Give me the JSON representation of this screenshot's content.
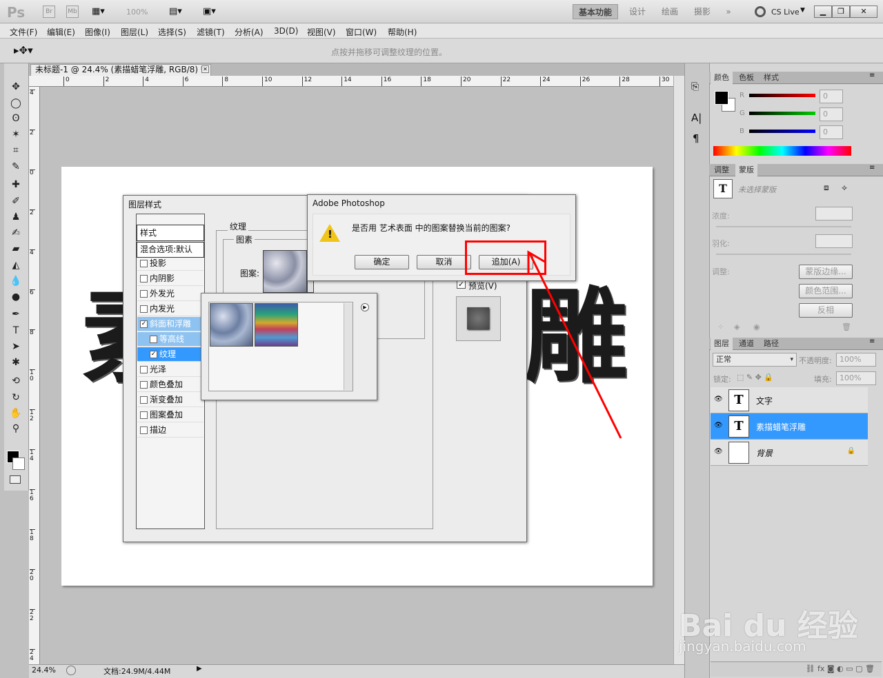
{
  "app": {
    "logo": "Ps",
    "bridge": "Br",
    "minibridge": "Mb",
    "zoom": "100%",
    "cslive": "CS Live"
  },
  "workspaces": [
    "基本功能",
    "设计",
    "绘画",
    "摄影"
  ],
  "menu": [
    "文件(F)",
    "编辑(E)",
    "图像(I)",
    "图层(L)",
    "选择(S)",
    "滤镜(T)",
    "分析(A)",
    "3D(D)",
    "视图(V)",
    "窗口(W)",
    "帮助(H)"
  ],
  "options": {
    "hint": "点按并拖移可调整纹理的位置。"
  },
  "document": {
    "tab_title": "未标题-1 @ 24.4% (素描蜡笔浮雕, RGB/8) *",
    "canvas_text_left": "素",
    "canvas_text_right": "雕",
    "zoom": "24.4%",
    "doc_size": "文档:24.9M/4.44M"
  },
  "ruler_h": [
    "0",
    "2",
    "4",
    "6",
    "8",
    "10",
    "12",
    "14",
    "16",
    "18",
    "20",
    "22",
    "24",
    "26",
    "28",
    "30"
  ],
  "ruler_v": [
    "4",
    "2",
    "0",
    "2",
    "4",
    "6",
    "8",
    "1 0",
    "1 2",
    "1 4",
    "1 6",
    "1 8",
    "2 0",
    "2 2",
    "2 4"
  ],
  "layer_style": {
    "title": "图层样式",
    "styles_header": "样式",
    "blend_options": "混合选项:默认",
    "items": [
      {
        "label": "投影",
        "checked": false
      },
      {
        "label": "内阴影",
        "checked": false
      },
      {
        "label": "外发光",
        "checked": false
      },
      {
        "label": "内发光",
        "checked": false
      },
      {
        "label": "斜面和浮雕",
        "checked": true
      },
      {
        "label": "等高线",
        "checked": false
      },
      {
        "label": "纹理",
        "checked": true
      },
      {
        "label": "光泽",
        "checked": false
      },
      {
        "label": "颜色叠加",
        "checked": false
      },
      {
        "label": "渐变叠加",
        "checked": false
      },
      {
        "label": "图案叠加",
        "checked": false
      },
      {
        "label": "描边",
        "checked": false
      }
    ],
    "texture_group": "纹理",
    "pattern_group": "图素",
    "pattern_label": "图案:",
    "preview_label": "预览(V)",
    "check_mark": "✓"
  },
  "alert": {
    "title": "Adobe Photoshop",
    "message": "是否用 艺术表面 中的图案替换当前的图案?",
    "ok": "确定",
    "cancel": "取消",
    "append": "追加(A)"
  },
  "color_panel": {
    "tabs": [
      "颜色",
      "色板",
      "样式"
    ],
    "r_label": "R",
    "g_label": "G",
    "b_label": "B",
    "r": "0",
    "g": "0",
    "b": "0"
  },
  "masks_panel": {
    "tabs": [
      "调整",
      "蒙版"
    ],
    "no_mask": "未选择蒙版",
    "density": "浓度:",
    "feather": "羽化:",
    "refine": "调整:",
    "mask_edge": "蒙版边缘...",
    "color_range": "颜色范围...",
    "invert": "反相"
  },
  "layers_panel": {
    "tabs": [
      "图层",
      "通道",
      "路径"
    ],
    "blend_mode": "正常",
    "opacity_label": "不透明度:",
    "opacity": "100%",
    "lock_label": "锁定:",
    "fill_label": "填充:",
    "fill": "100%",
    "layers": [
      {
        "name": "文字",
        "thumb": "T",
        "selected": false
      },
      {
        "name": "素描蜡笔浮雕",
        "thumb": "T",
        "selected": true
      },
      {
        "name": "背景",
        "thumb": "",
        "selected": false
      }
    ]
  },
  "watermark": {
    "brand": "Bai  du 经验",
    "url": "jingyan.baidu.com"
  },
  "colors": {
    "accent": "#3399ff",
    "highlight": "#ff0000"
  }
}
